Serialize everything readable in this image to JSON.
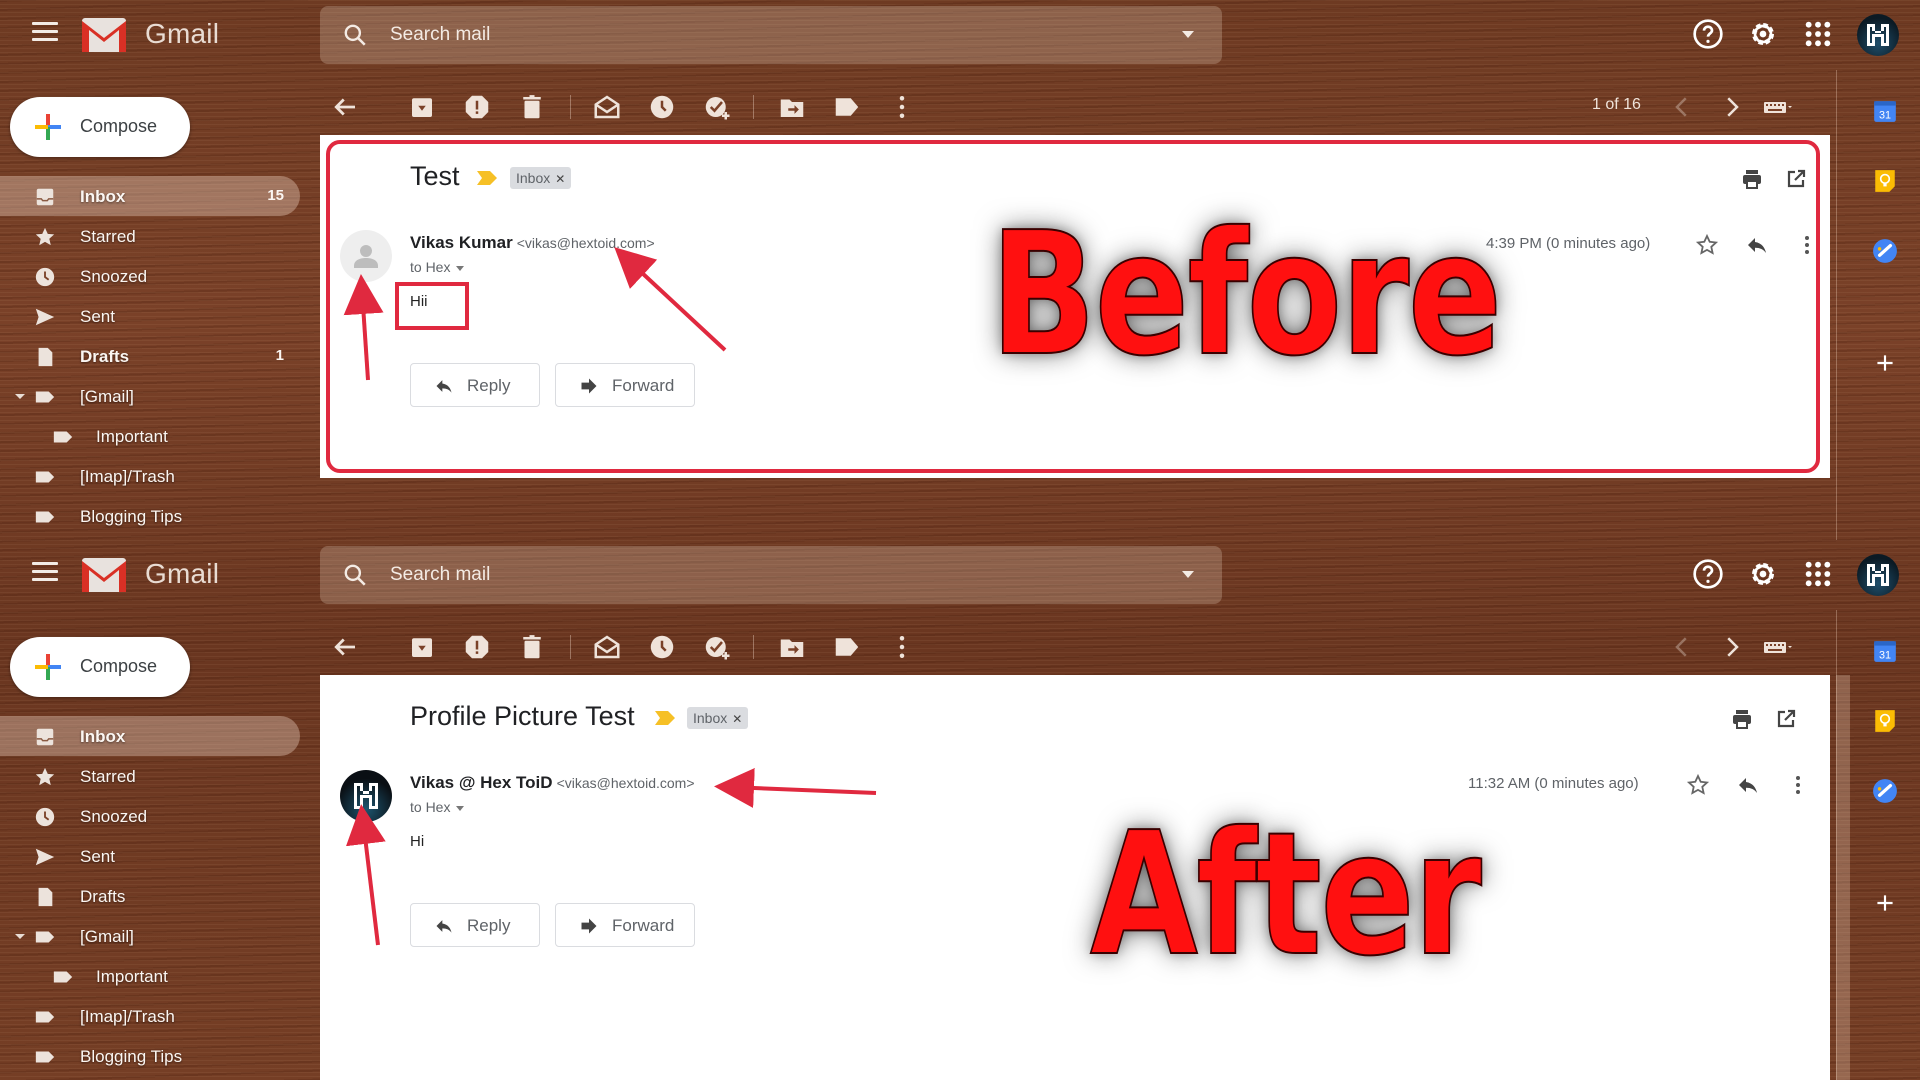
{
  "app": {
    "name": "Gmail"
  },
  "search": {
    "placeholder": "Search mail"
  },
  "compose": {
    "label": "Compose"
  },
  "panels": [
    {
      "id": "before",
      "annotation": "Before",
      "sidebar": [
        {
          "label": "Inbox",
          "count": "15",
          "icon": "inbox-icon",
          "active": true,
          "bold": true
        },
        {
          "label": "Starred",
          "count": "",
          "icon": "star-icon"
        },
        {
          "label": "Snoozed",
          "count": "",
          "icon": "clock-icon"
        },
        {
          "label": "Sent",
          "count": "",
          "icon": "send-icon"
        },
        {
          "label": "Drafts",
          "count": "1",
          "icon": "draft-icon",
          "bold": true
        },
        {
          "label": "[Gmail]",
          "count": "",
          "icon": "label-icon",
          "expandable": true
        },
        {
          "label": "Important",
          "count": "",
          "icon": "label-icon",
          "sub": true
        },
        {
          "label": "[Imap]/Trash",
          "count": "",
          "icon": "label-icon"
        },
        {
          "label": "Blogging Tips",
          "count": "",
          "icon": "label-icon"
        }
      ],
      "pager": "1 of 16",
      "email": {
        "subject": "Test",
        "label_chip": "Inbox",
        "sender_name": "Vikas Kumar",
        "sender_email": "<vikas@hextoid.com>",
        "to": "to Hex",
        "body": "Hii",
        "timestamp": "4:39 PM (0 minutes ago)",
        "avatar": "default-avatar"
      }
    },
    {
      "id": "after",
      "annotation": "After",
      "sidebar": [
        {
          "label": "Inbox",
          "count": "",
          "icon": "inbox-icon",
          "active": true,
          "bold": true
        },
        {
          "label": "Starred",
          "count": "",
          "icon": "star-icon"
        },
        {
          "label": "Snoozed",
          "count": "",
          "icon": "clock-icon"
        },
        {
          "label": "Sent",
          "count": "",
          "icon": "send-icon"
        },
        {
          "label": "Drafts",
          "count": "",
          "icon": "draft-icon"
        },
        {
          "label": "[Gmail]",
          "count": "",
          "icon": "label-icon",
          "expandable": true
        },
        {
          "label": "Important",
          "count": "",
          "icon": "label-icon",
          "sub": true
        },
        {
          "label": "[Imap]/Trash",
          "count": "",
          "icon": "label-icon"
        },
        {
          "label": "Blogging Tips",
          "count": "",
          "icon": "label-icon"
        }
      ],
      "pager": "",
      "email": {
        "subject": "Profile Picture Test",
        "label_chip": "Inbox",
        "sender_name": "Vikas @ Hex ToiD",
        "sender_email": "<vikas@hextoid.com>",
        "to": "to Hex",
        "body": "Hi",
        "timestamp": "11:32 AM (0 minutes ago)",
        "avatar": "hextoid-logo-avatar"
      }
    }
  ],
  "actions": {
    "reply": "Reply",
    "forward": "Forward"
  },
  "colors": {
    "annotation_red": "#e0293f",
    "label_red": "#ff1010",
    "compose_plus": [
      "#ea4335",
      "#4285f4",
      "#34a853",
      "#fbbc04"
    ]
  }
}
